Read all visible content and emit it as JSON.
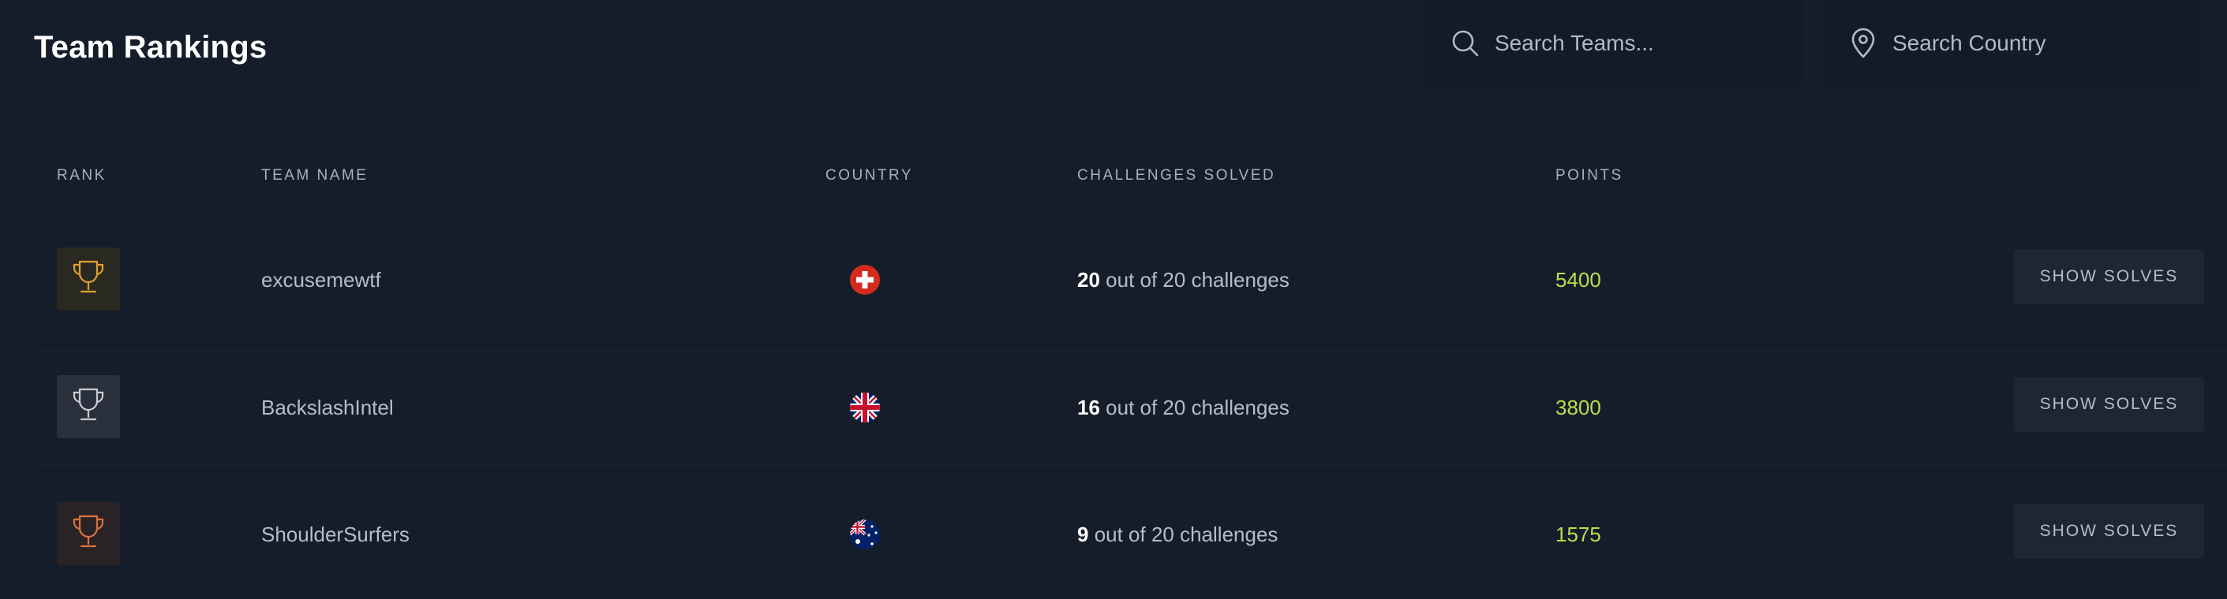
{
  "header": {
    "title": "Team Rankings",
    "search_teams_placeholder": "Search Teams...",
    "search_country_placeholder": "Search Country"
  },
  "table": {
    "columns": [
      "RANK",
      "TEAM NAME",
      "COUNTRY",
      "CHALLENGES SOLVED",
      "POINTS"
    ],
    "rows": [
      {
        "rank_icon": "trophy-gold-icon",
        "team": "excusemewtf",
        "country_flag": "switzerland-flag-icon",
        "solved_count": "20",
        "solved_suffix": " out of 20 challenges",
        "points": "5400",
        "action": "SHOW SOLVES"
      },
      {
        "rank_icon": "trophy-silver-icon",
        "team": "BackslashIntel",
        "country_flag": "united-kingdom-flag-icon",
        "solved_count": "16",
        "solved_suffix": " out of 20 challenges",
        "points": "3800",
        "action": "SHOW SOLVES"
      },
      {
        "rank_icon": "trophy-bronze-icon",
        "team": "ShoulderSurfers",
        "country_flag": "australia-flag-icon",
        "solved_count": "9",
        "solved_suffix": " out of 20 challenges",
        "points": "1575",
        "action": "SHOW SOLVES"
      }
    ]
  },
  "colors": {
    "background": "#161d2a",
    "gold": "#e0a030",
    "silver": "#c8ccd4",
    "bronze": "#d9723a",
    "points": "#b7e04a"
  }
}
